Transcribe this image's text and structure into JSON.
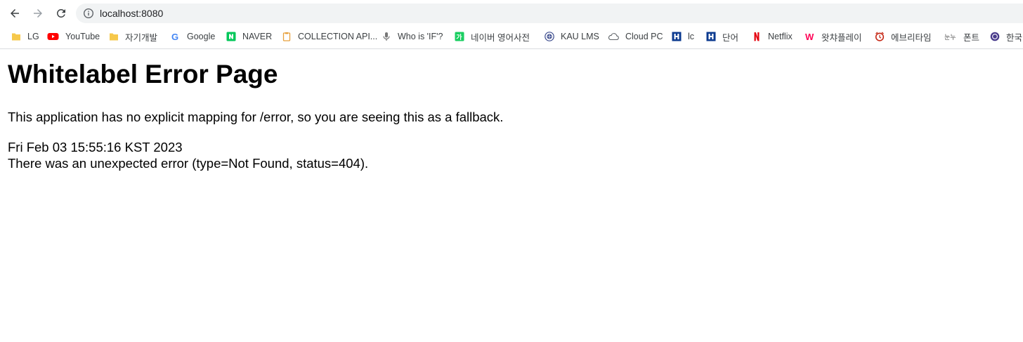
{
  "browser": {
    "url": "localhost:8080",
    "bookmarks": [
      {
        "label": "LG",
        "icon": "folder-icon"
      },
      {
        "label": "YouTube",
        "icon": "youtube-icon"
      },
      {
        "label": "자기개발",
        "icon": "folder-icon"
      },
      {
        "label": "Google",
        "icon": "google-icon"
      },
      {
        "label": "NAVER",
        "icon": "naver-icon"
      },
      {
        "label": "COLLECTION API...",
        "icon": "clipboard-icon"
      },
      {
        "label": "Who is 'IF'?",
        "icon": "microphone-icon"
      },
      {
        "label": "네이버 영어사전",
        "icon": "naver-dictionary-icon"
      },
      {
        "label": "KAU LMS",
        "icon": "university-seal-icon"
      },
      {
        "label": "Cloud PC",
        "icon": "cloud-icon"
      },
      {
        "label": "lc",
        "icon": "hackers-icon"
      },
      {
        "label": "단어",
        "icon": "hackers-icon"
      },
      {
        "label": "Netflix",
        "icon": "netflix-icon"
      },
      {
        "label": "왓챠플레이",
        "icon": "watcha-icon"
      },
      {
        "label": "에브리타임",
        "icon": "everytime-icon"
      },
      {
        "label": "폰트",
        "icon": "font-icon"
      },
      {
        "label": "한국",
        "icon": "emblem-icon"
      }
    ]
  },
  "page": {
    "title": "Whitelabel Error Page",
    "description": "This application has no explicit mapping for /error, so you are seeing this as a fallback.",
    "timestamp": "Fri Feb 03 15:55:16 KST 2023",
    "error_message": "There was an unexpected error (type=Not Found, status=404)."
  }
}
